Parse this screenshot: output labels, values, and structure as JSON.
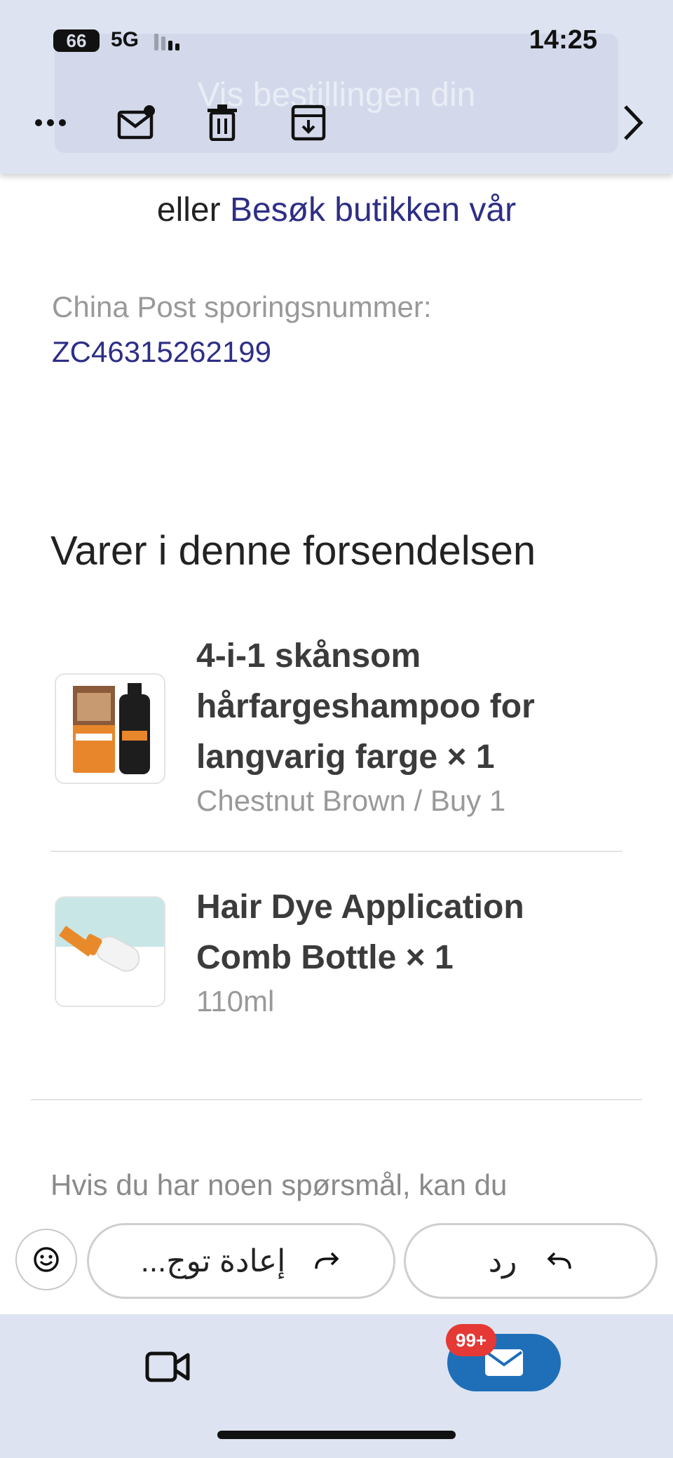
{
  "status_bar": {
    "battery": "66",
    "network": "5G",
    "time": "14:25"
  },
  "header": {
    "banner_button": "Vis bestillingen din",
    "toolbar": {
      "more_icon": "ellipsis-icon",
      "mark_unread_icon": "mail-unread-icon",
      "delete_icon": "trash-icon",
      "archive_icon": "archive-icon",
      "next_icon": "chevron-right-icon"
    }
  },
  "email": {
    "visit_prefix": "eller",
    "visit_link": "Besøk butikken vår",
    "tracking_label": "China Post sporingsnummer:",
    "tracking_number": "ZC46315262199",
    "section_title": "Varer i denne forsendelsen",
    "items": [
      {
        "title": "4-i-1 skånsom hårfargeshampoo for langvarig farge × 1",
        "variant": "Chestnut Brown / Buy 1"
      },
      {
        "title": "Hair Dye Application Comb Bottle × 1",
        "variant": "110ml"
      }
    ],
    "question_text": "Hvis du har noen spørsmål, kan du"
  },
  "reply_bar": {
    "forward_label": "إعادة توج...",
    "reply_label": "رد"
  },
  "bottom_nav": {
    "badge": "99+"
  },
  "colors": {
    "link": "#2e2e86",
    "bar_bg": "#dde3f0",
    "mail_tab": "#1f6fb8",
    "badge": "#e53935"
  }
}
